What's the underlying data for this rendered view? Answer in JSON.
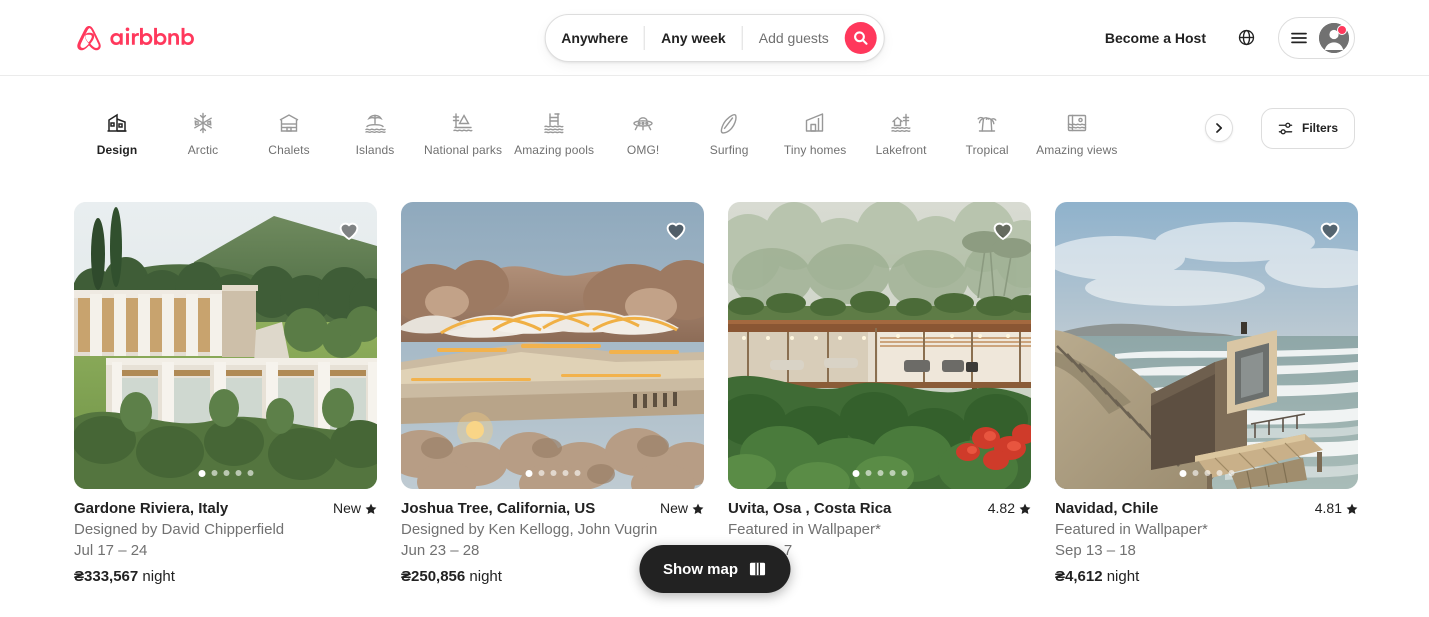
{
  "header": {
    "logo_text": "airbnb",
    "logo_icon": "airbnb-bello-icon",
    "search": {
      "location_label": "Anywhere",
      "dates_label": "Any week",
      "guests_placeholder": "Add guests",
      "search_icon": "search-icon"
    },
    "become_host_label": "Become a Host",
    "globe_icon": "globe-icon",
    "menu_icon": "hamburger-menu-icon",
    "avatar_icon": "user-avatar-icon",
    "notification_color": "#ff385c"
  },
  "categories": {
    "active": "Design",
    "items": [
      {
        "label": "Design",
        "icon": "design-building-icon"
      },
      {
        "label": "Arctic",
        "icon": "snowflake-icon"
      },
      {
        "label": "Chalets",
        "icon": "cabin-icon"
      },
      {
        "label": "Islands",
        "icon": "island-palm-icon"
      },
      {
        "label": "National parks",
        "icon": "national-park-icon"
      },
      {
        "label": "Amazing pools",
        "icon": "pool-icon"
      },
      {
        "label": "OMG!",
        "icon": "ufo-icon"
      },
      {
        "label": "Surfing",
        "icon": "surfboard-icon"
      },
      {
        "label": "Tiny homes",
        "icon": "tiny-home-icon"
      },
      {
        "label": "Lakefront",
        "icon": "lakefront-icon"
      },
      {
        "label": "Tropical",
        "icon": "tropical-palms-icon"
      },
      {
        "label": "Amazing views",
        "icon": "amazing-views-icon"
      }
    ],
    "next_icon": "chevron-right-icon",
    "filters_label": "Filters",
    "filters_icon": "filter-sliders-icon"
  },
  "listings": [
    {
      "title": "Gardone Riviera, Italy",
      "subtitle": "Designed by David Chipperfield",
      "dates": "Jul 17 – 24",
      "price_amount": "₴333,567",
      "price_unit": "night",
      "rating": "New",
      "rating_icon": "star-icon",
      "favorite_icon": "heart-icon",
      "dots": 5,
      "active_dot": 1
    },
    {
      "title": "Joshua Tree, California, US",
      "subtitle": "Designed by Ken Kellogg, John Vugrin",
      "dates": "Jun 23 – 28",
      "price_amount": "₴250,856",
      "price_unit": "night",
      "rating": "New",
      "rating_icon": "star-icon",
      "favorite_icon": "heart-icon",
      "dots": 5,
      "active_dot": 1
    },
    {
      "title": "Uvita, Osa , Costa Rica",
      "subtitle": "Featured in Wallpaper*",
      "dates": "Sep 2 – 7",
      "price_amount": "₴",
      "price_unit": "night",
      "rating": "4.82",
      "rating_icon": "star-icon",
      "favorite_icon": "heart-icon",
      "dots": 5,
      "active_dot": 1
    },
    {
      "title": "Navidad, Chile",
      "subtitle": "Featured in Wallpaper*",
      "dates": "Sep 13 – 18",
      "price_amount": "₴4,612",
      "price_unit": "night",
      "rating": "4.81",
      "rating_icon": "star-icon",
      "favorite_icon": "heart-icon",
      "dots": 5,
      "active_dot": 1
    }
  ],
  "show_map": {
    "label": "Show map",
    "icon": "map-icon"
  }
}
